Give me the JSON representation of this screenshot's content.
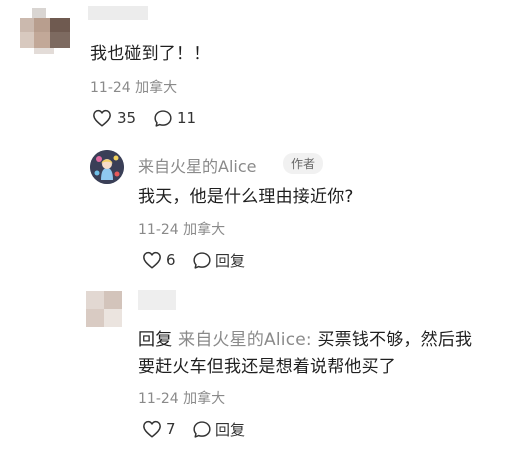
{
  "comment": {
    "text": "我也碰到了！！",
    "meta": "11-24 加拿大",
    "likes": "35",
    "replies": "11"
  },
  "reply1": {
    "author": "来自火星的Alice",
    "author_tag": "作者",
    "text": "我天，他是什么理由接近你?",
    "meta": "11-24 加拿大",
    "likes": "6",
    "reply_label": "回复"
  },
  "reply2": {
    "reply_prefix": "回复",
    "reply_to": "来自火星的Alice:",
    "text_line1": "买票钱不够，然后我",
    "text_line2": "要赶火车但我还是想着说帮他买了",
    "meta": "11-24 加拿大",
    "likes": "7",
    "reply_label": "回复"
  }
}
